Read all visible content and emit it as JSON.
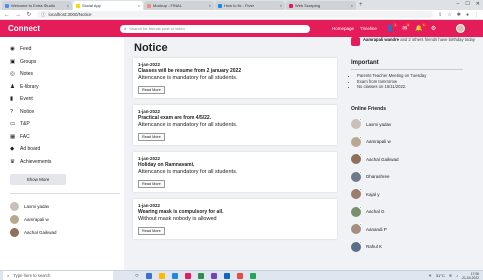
{
  "browser": {
    "tabs": [
      {
        "label": "Welcome to Extra Studio",
        "color": "#4c8bf5"
      },
      {
        "label": "Social App",
        "color": "#ffd700"
      },
      {
        "label": "Mockup - FINAL",
        "color": "#f28b82"
      },
      {
        "label": "How to fix - Fiver",
        "color": "#1e88e5"
      },
      {
        "label": "Web Scraping",
        "color": "#e41c5a"
      }
    ],
    "url": "localhost:3000/Notice"
  },
  "topbar": {
    "logo": "Connect",
    "search_placeholder": "Search for friends post or video",
    "links": [
      "Homepage",
      "Timeline"
    ],
    "badges": [
      "1",
      "2",
      "1"
    ]
  },
  "sidebar": {
    "items": [
      {
        "label": "Feed",
        "icon": "rss-icon"
      },
      {
        "label": "Groups",
        "icon": "chat-icon"
      },
      {
        "label": "Notes",
        "icon": "note-icon"
      },
      {
        "label": "E-library",
        "icon": "people-icon"
      },
      {
        "label": "Event",
        "icon": "bookmark-icon"
      },
      {
        "label": "Notice",
        "icon": "help-icon"
      },
      {
        "label": "T&P",
        "icon": "briefcase-icon"
      },
      {
        "label": "FAC",
        "icon": "calendar-icon"
      },
      {
        "label": "Ad board",
        "icon": "graduation-icon"
      },
      {
        "label": "Achievements",
        "icon": "trophy-icon"
      }
    ],
    "show_more": "Show More",
    "friends": [
      {
        "name": "Laxmi yadav",
        "color": "#c9c0b6"
      },
      {
        "name": "Aamrapali w",
        "color": "#b9a890"
      },
      {
        "name": "Aachal Gaikwad",
        "color": "#8d6f5a"
      }
    ]
  },
  "feed": {
    "title": "Notice",
    "read_more_label": "Read More",
    "posts": [
      {
        "date": "1-jan-2022",
        "title": "Classes will be resume from 2 january 2022",
        "body": "Attencance is mandatory for all students."
      },
      {
        "date": "1-jan-2022",
        "title": "Practical exam are from 4/5/22.",
        "body": "Attencance is mandatory for all students."
      },
      {
        "date": "1-jan-2022",
        "title": "Holiday on Ramnavami.",
        "body": "Attencance is mandatory for all students."
      },
      {
        "date": "1-jan-2022",
        "title": "Wearing mask is compulsory for all.",
        "body": "Without mask nobody is allowed"
      }
    ]
  },
  "rightbar": {
    "birthday_name": "Aamrapali wandre",
    "birthday_rest": " and 2 others friends have birthday today",
    "important_title": "Important",
    "important_items": [
      "Parents Teacher Meeting on Tuesday",
      "Exam from tommrrow",
      "No classes on 16/11/2022."
    ],
    "online_title": "Online Friends",
    "online_friends": [
      {
        "name": "Laxmi yadav",
        "color": "#c9c0b6"
      },
      {
        "name": "Aamrapali w",
        "color": "#b9a890"
      },
      {
        "name": "Aachal Gaikwad",
        "color": "#8d6f5a"
      },
      {
        "name": "Dharashree",
        "color": "#6d7b8a"
      },
      {
        "name": "Kajal y",
        "color": "#9a7d6a"
      },
      {
        "name": "Aachal G",
        "color": "#7a8f6a"
      },
      {
        "name": "Aanandi P",
        "color": "#a58e7e"
      },
      {
        "name": "Rahul K",
        "color": "#5b6f88"
      }
    ]
  },
  "taskbar": {
    "search_placeholder": "Type here to search",
    "weather": "31°C",
    "time": "17:06",
    "date": "21-04-2022",
    "apps": [
      "#3a6fd8",
      "#ffb900",
      "#1e88e5",
      "#e41c5a",
      "#2d8f4e",
      "#7a3fbf",
      "#0a66c2",
      "#e74c3c",
      "#25a75b"
    ]
  }
}
